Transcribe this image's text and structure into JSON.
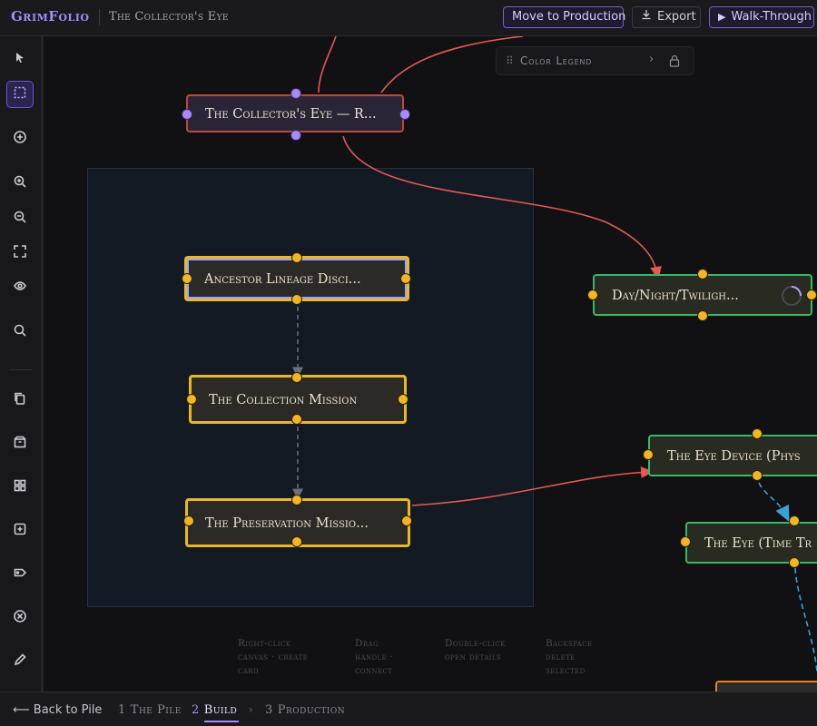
{
  "header": {
    "brand": "GrimFolio",
    "doc_title": "The Collector's Eye",
    "move_to_production": "Move to Production",
    "export": "Export",
    "walk_through": "Walk-Through"
  },
  "toolbar": {
    "tools": [
      "select-tool",
      "marquee-tool",
      "add-node-tool",
      "zoom-in-tool",
      "zoom-out-tool",
      "fit-view-tool",
      "hide-tool",
      "search-tool",
      "duplicate-tool",
      "group-tool",
      "grid-tool",
      "add-card-tool",
      "tag-tool",
      "delete-tool",
      "edit-tool"
    ],
    "active": "marquee-tool"
  },
  "legend": {
    "label": "Color Legend"
  },
  "nodes": {
    "collectors_eye": "The Collector's Eye — R...",
    "ancestor": "Ancestor Lineage Disci...",
    "collection": "The Collection Mission",
    "preservation": "The Preservation Missio...",
    "daynight": "Day/Night/Twiligh...",
    "eye_device": "The Eye Device (Phys",
    "eye_time": "The Eye (Time Tr"
  },
  "hints": [
    {
      "line1": "Right-click",
      "line2": "canvas · create",
      "line3": "card"
    },
    {
      "line1": "Drag",
      "line2": "handle ·",
      "line3": "connect"
    },
    {
      "line1": "Double-click",
      "line2": "open details",
      "line3": ""
    },
    {
      "line1": "Backspace",
      "line2": "delete",
      "line3": "selected"
    }
  ],
  "footer": {
    "back": "Back to Pile",
    "steps": [
      {
        "num": "1",
        "label": "The Pile"
      },
      {
        "num": "2",
        "label": "Build"
      },
      {
        "num": "3",
        "label": "Production"
      }
    ],
    "active_step": "Build"
  },
  "colors": {
    "accent": "#a78bfa",
    "node_red": "#c0453e",
    "node_yellow": "#e8b82a",
    "node_green": "#37b86a",
    "node_orange": "#e0842a",
    "edge_blue": "#3b9fd8"
  }
}
